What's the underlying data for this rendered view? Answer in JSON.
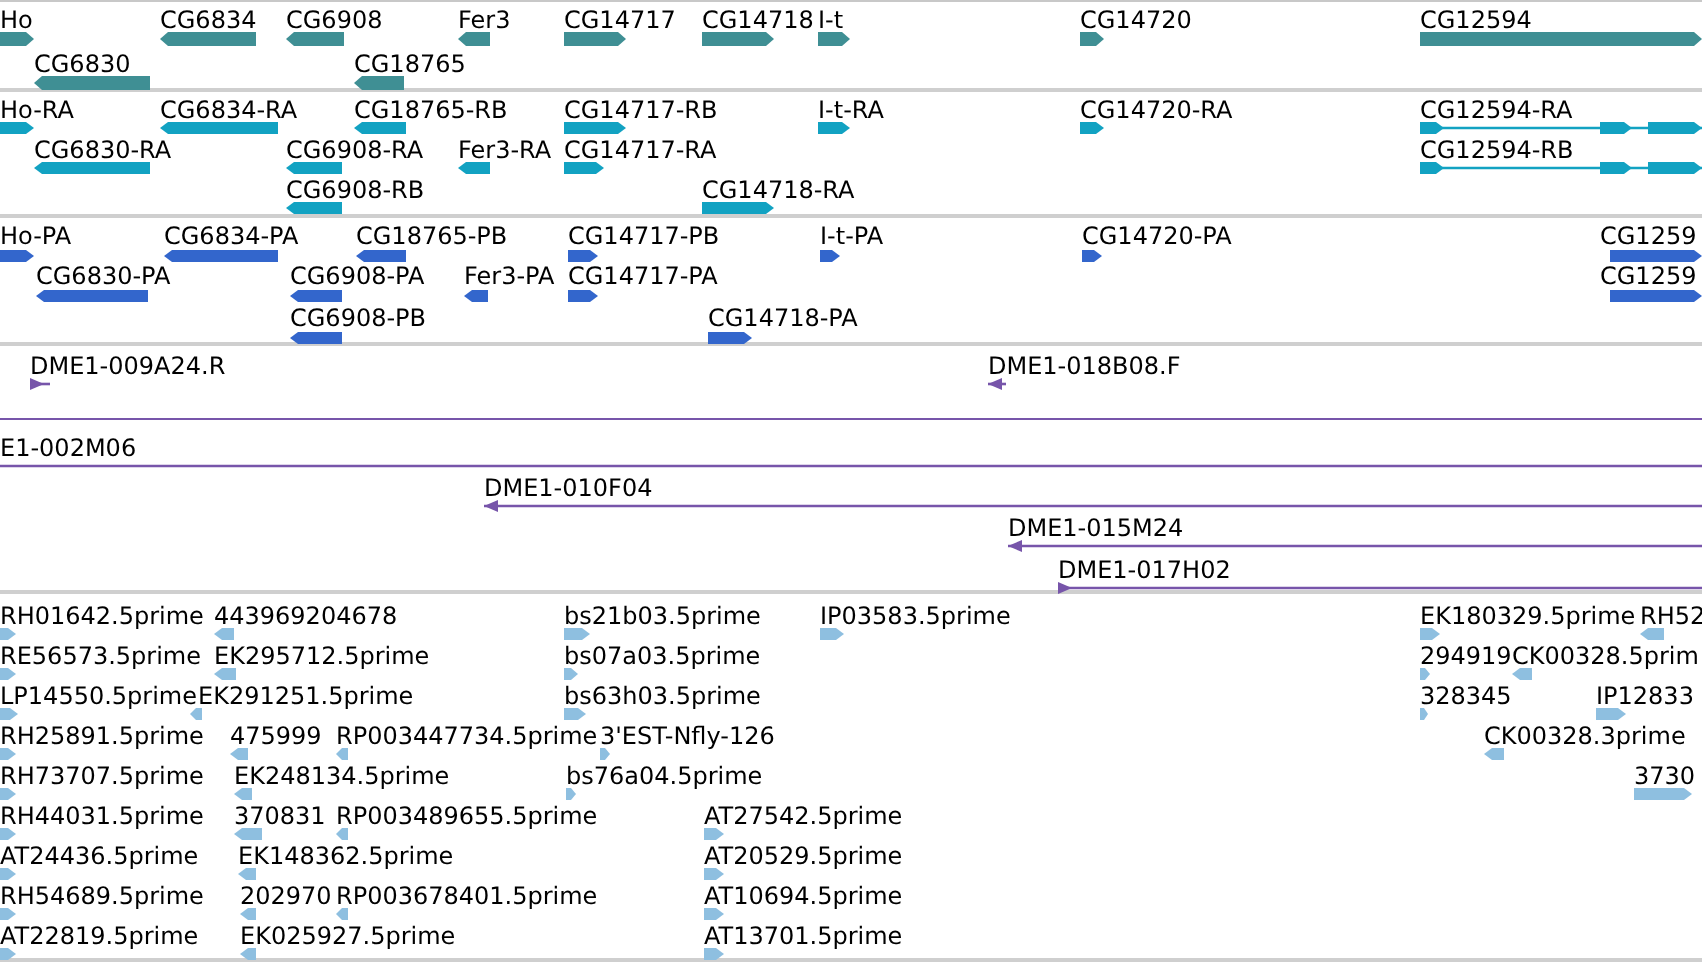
{
  "tracks": [
    {
      "kind": "gene",
      "features": [
        {
          "label": "Ho",
          "reverse": false
        },
        {
          "label": "CG6834",
          "reverse": true
        },
        {
          "label": "CG6908",
          "reverse": true
        },
        {
          "label": "Fer3",
          "reverse": true
        },
        {
          "label": "CG14717",
          "reverse": false
        },
        {
          "label": "CG14718",
          "reverse": false
        },
        {
          "label": "I-t",
          "reverse": false
        },
        {
          "label": "CG14720",
          "reverse": false
        },
        {
          "label": "CG12594",
          "reverse": false
        },
        {
          "label": "CG6830",
          "reverse": true
        },
        {
          "label": "CG18765",
          "reverse": true
        }
      ]
    },
    {
      "kind": "transcript",
      "features": [
        {
          "label": "Ho-RA",
          "reverse": false
        },
        {
          "label": "CG6834-RA",
          "reverse": true
        },
        {
          "label": "CG18765-RB",
          "reverse": true
        },
        {
          "label": "CG14717-RB",
          "reverse": false
        },
        {
          "label": "I-t-RA",
          "reverse": false
        },
        {
          "label": "CG14720-RA",
          "reverse": false
        },
        {
          "label": "CG12594-RA",
          "reverse": false
        },
        {
          "label": "CG6830-RA",
          "reverse": true
        },
        {
          "label": "CG6908-RA",
          "reverse": true
        },
        {
          "label": "Fer3-RA",
          "reverse": true
        },
        {
          "label": "CG14717-RA",
          "reverse": false
        },
        {
          "label": "CG12594-RB",
          "reverse": false
        },
        {
          "label": "CG6908-RB",
          "reverse": true
        },
        {
          "label": "CG14718-RA",
          "reverse": false
        }
      ]
    },
    {
      "kind": "protein",
      "features": [
        {
          "label": "Ho-PA",
          "reverse": false
        },
        {
          "label": "CG6834-PA",
          "reverse": true
        },
        {
          "label": "CG18765-PB",
          "reverse": true
        },
        {
          "label": "CG14717-PB",
          "reverse": false
        },
        {
          "label": "I-t-PA",
          "reverse": false
        },
        {
          "label": "CG14720-PA",
          "reverse": false
        },
        {
          "label": "CG1259",
          "reverse": false
        },
        {
          "label": "CG6830-PA",
          "reverse": true
        },
        {
          "label": "CG6908-PA",
          "reverse": true
        },
        {
          "label": "Fer3-PA",
          "reverse": true
        },
        {
          "label": "CG14717-PA",
          "reverse": false
        },
        {
          "label": "CG1259",
          "reverse": false
        },
        {
          "label": "CG6908-PB",
          "reverse": true
        },
        {
          "label": "CG14718-PA",
          "reverse": false
        }
      ]
    },
    {
      "kind": "clone",
      "features": [
        {
          "label": "DME1-009A24.R",
          "reverse": false
        },
        {
          "label": "DME1-018B08.F",
          "reverse": true
        },
        {
          "label": "E1-002M06"
        },
        {
          "label": "DME1-010F04",
          "reverse": true
        },
        {
          "label": "DME1-015M24",
          "reverse": true
        },
        {
          "label": "DME1-017H02",
          "reverse": false
        }
      ]
    },
    {
      "kind": "est",
      "features": [
        {
          "label": "RH01642.5prime",
          "reverse": false
        },
        {
          "label": "443969204678",
          "reverse": true
        },
        {
          "label": "bs21b03.5prime",
          "reverse": false
        },
        {
          "label": "IP03583.5prime",
          "reverse": false
        },
        {
          "label": "EK180329.5prime",
          "reverse": false
        },
        {
          "label": "RH52",
          "reverse": true
        },
        {
          "label": "RE56573.5prime",
          "reverse": false
        },
        {
          "label": "EK295712.5prime",
          "reverse": true
        },
        {
          "label": "bs07a03.5prime",
          "reverse": false
        },
        {
          "label": "294919",
          "reverse": false
        },
        {
          "label": "CK00328.5prim",
          "reverse": true
        },
        {
          "label": "LP14550.5prime",
          "reverse": false
        },
        {
          "label": "EK291251.5prime",
          "reverse": true
        },
        {
          "label": "bs63h03.5prime",
          "reverse": false
        },
        {
          "label": "328345",
          "reverse": false
        },
        {
          "label": "IP12833",
          "reverse": false
        },
        {
          "label": "RH25891.5prime",
          "reverse": false
        },
        {
          "label": "475999",
          "reverse": true
        },
        {
          "label": "RP003447734.5prime",
          "reverse": true
        },
        {
          "label": "3'EST-Nfly-126",
          "reverse": false
        },
        {
          "label": "CK00328.3prime",
          "reverse": true
        },
        {
          "label": "RH73707.5prime",
          "reverse": false
        },
        {
          "label": "EK248134.5prime",
          "reverse": true
        },
        {
          "label": "bs76a04.5prime",
          "reverse": false
        },
        {
          "label": "3730",
          "reverse": false
        },
        {
          "label": "RH44031.5prime",
          "reverse": false
        },
        {
          "label": "370831",
          "reverse": true
        },
        {
          "label": "RP003489655.5prime",
          "reverse": true
        },
        {
          "label": "AT27542.5prime",
          "reverse": false
        },
        {
          "label": "AT24436.5prime",
          "reverse": false
        },
        {
          "label": "EK148362.5prime",
          "reverse": true
        },
        {
          "label": "AT20529.5prime",
          "reverse": false
        },
        {
          "label": "RH54689.5prime",
          "reverse": false
        },
        {
          "label": "202970",
          "reverse": true
        },
        {
          "label": "RP003678401.5prime",
          "reverse": true
        },
        {
          "label": "AT10694.5prime",
          "reverse": false
        },
        {
          "label": "AT22819.5prime",
          "reverse": false
        },
        {
          "label": "EK025927.5prime",
          "reverse": true
        },
        {
          "label": "AT13701.5prime",
          "reverse": false
        }
      ]
    }
  ]
}
